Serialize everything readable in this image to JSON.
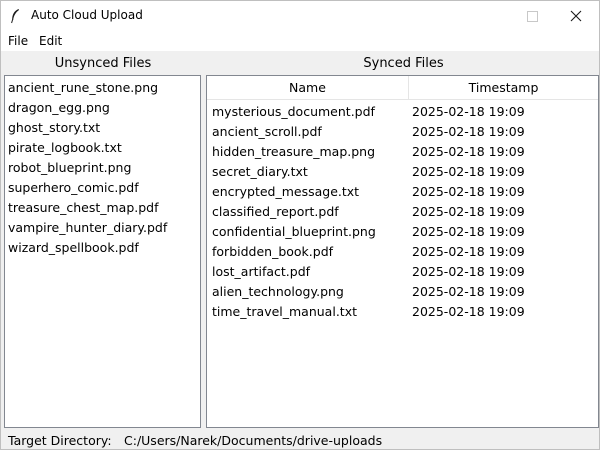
{
  "window": {
    "title": "Auto Cloud Upload",
    "icon": "feather-icon"
  },
  "menu": {
    "file": "File",
    "edit": "Edit"
  },
  "unsynced": {
    "label": "Unsynced Files",
    "items": [
      "ancient_rune_stone.png",
      "dragon_egg.png",
      "ghost_story.txt",
      "pirate_logbook.txt",
      "robot_blueprint.png",
      "superhero_comic.pdf",
      "treasure_chest_map.pdf",
      "vampire_hunter_diary.pdf",
      "wizard_spellbook.pdf"
    ]
  },
  "synced": {
    "label": "Synced Files",
    "columns": {
      "name": "Name",
      "timestamp": "Timestamp"
    },
    "rows": [
      {
        "name": "mysterious_document.pdf",
        "timestamp": "2025-02-18  19:09"
      },
      {
        "name": "ancient_scroll.pdf",
        "timestamp": "2025-02-18  19:09"
      },
      {
        "name": "hidden_treasure_map.png",
        "timestamp": "2025-02-18  19:09"
      },
      {
        "name": "secret_diary.txt",
        "timestamp": "2025-02-18  19:09"
      },
      {
        "name": "encrypted_message.txt",
        "timestamp": "2025-02-18  19:09"
      },
      {
        "name": "classified_report.pdf",
        "timestamp": "2025-02-18  19:09"
      },
      {
        "name": "confidential_blueprint.png",
        "timestamp": "2025-02-18  19:09"
      },
      {
        "name": "forbidden_book.pdf",
        "timestamp": "2025-02-18  19:09"
      },
      {
        "name": "lost_artifact.pdf",
        "timestamp": "2025-02-18  19:09"
      },
      {
        "name": "alien_technology.png",
        "timestamp": "2025-02-18  19:09"
      },
      {
        "name": "time_travel_manual.txt",
        "timestamp": "2025-02-18  19:09"
      }
    ]
  },
  "status": {
    "target_label": "Target Directory:",
    "target_path": "C:/Users/Narek/Documents/drive-uploads"
  }
}
